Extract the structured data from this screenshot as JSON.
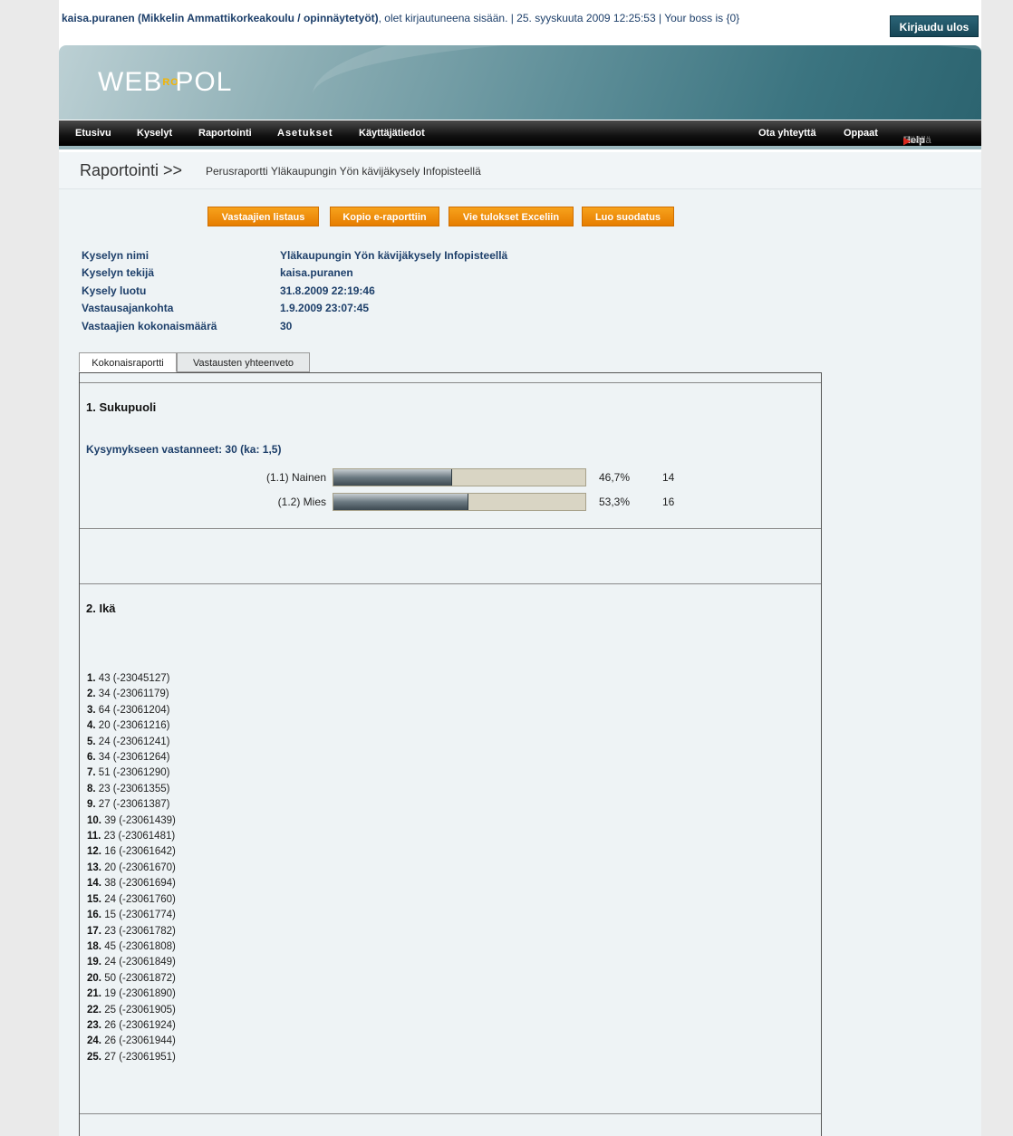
{
  "header": {
    "user": "kaisa.puranen (Mikkelin Ammattikorkeakoulu / opinnäytetyöt)",
    "status_line": ", olet kirjautuneena sisään. | 25. syyskuuta 2009 12:25:53 | Your boss is {0}",
    "logout_label": "Kirjaudu ulos"
  },
  "logo": {
    "left": "WEB",
    "ro": "RO",
    "right": "POL"
  },
  "nav": {
    "left": [
      "Etusivu",
      "Kyselyt",
      "Raportointi",
      "Asetukset",
      "Käyttäjätiedot"
    ],
    "right": [
      "Ota yhteyttä",
      "Oppaat"
    ],
    "help_label": "Help",
    "help_state": "Päällä"
  },
  "breadcrumb": {
    "title": "Raportointi >>",
    "subtitle": "Perusraportti Yläkaupungin Yön kävijäkysely Infopisteellä"
  },
  "actions": [
    "Vastaajien listaus",
    "Kopio e-raporttiin",
    "Vie tulokset Exceliin",
    "Luo suodatus"
  ],
  "survey_info": [
    {
      "label": "Kyselyn nimi",
      "value": "Yläkaupungin Yön kävijäkysely Infopisteellä"
    },
    {
      "label": "Kyselyn tekijä",
      "value": "kaisa.puranen"
    },
    {
      "label": "Kysely luotu",
      "value": "31.8.2009 22:19:46"
    },
    {
      "label": "Vastausajankohta",
      "value": "1.9.2009 23:07:45"
    },
    {
      "label": "Vastaajien kokonaismäärä",
      "value": "30"
    }
  ],
  "tabs": [
    "Kokonaisraportti",
    "Vastausten yhteenveto"
  ],
  "q1": {
    "title": "1. Sukupuoli",
    "answered": "Kysymykseen vastanneet: 30 (ka: 1,5)",
    "options": [
      {
        "label": "(1.1) Nainen",
        "pct_text": "46,7%",
        "fraction": 0.467,
        "count": "14"
      },
      {
        "label": "(1.2) Mies",
        "pct_text": "53,3%",
        "fraction": 0.533,
        "count": "16"
      }
    ]
  },
  "q2": {
    "title": "2. Ikä",
    "answers": [
      {
        "n": "1.",
        "text": "43 (-23045127)"
      },
      {
        "n": "2.",
        "text": "34 (-23061179)"
      },
      {
        "n": "3.",
        "text": "64 (-23061204)"
      },
      {
        "n": "4.",
        "text": "20 (-23061216)"
      },
      {
        "n": "5.",
        "text": "24 (-23061241)"
      },
      {
        "n": "6.",
        "text": "34 (-23061264)"
      },
      {
        "n": "7.",
        "text": "51 (-23061290)"
      },
      {
        "n": "8.",
        "text": "23 (-23061355)"
      },
      {
        "n": "9.",
        "text": "27 (-23061387)"
      },
      {
        "n": "10.",
        "text": "39 (-23061439)"
      },
      {
        "n": "11.",
        "text": "23 (-23061481)"
      },
      {
        "n": "12.",
        "text": "16 (-23061642)"
      },
      {
        "n": "13.",
        "text": "20 (-23061670)"
      },
      {
        "n": "14.",
        "text": "38 (-23061694)"
      },
      {
        "n": "15.",
        "text": "24 (-23061760)"
      },
      {
        "n": "16.",
        "text": "15 (-23061774)"
      },
      {
        "n": "17.",
        "text": "23 (-23061782)"
      },
      {
        "n": "18.",
        "text": "45 (-23061808)"
      },
      {
        "n": "19.",
        "text": "24 (-23061849)"
      },
      {
        "n": "20.",
        "text": "50 (-23061872)"
      },
      {
        "n": "21.",
        "text": "19 (-23061890)"
      },
      {
        "n": "22.",
        "text": "25 (-23061905)"
      },
      {
        "n": "23.",
        "text": "26 (-23061924)"
      },
      {
        "n": "24.",
        "text": "26 (-23061944)"
      },
      {
        "n": "25.",
        "text": "27 (-23061951)"
      }
    ]
  }
}
